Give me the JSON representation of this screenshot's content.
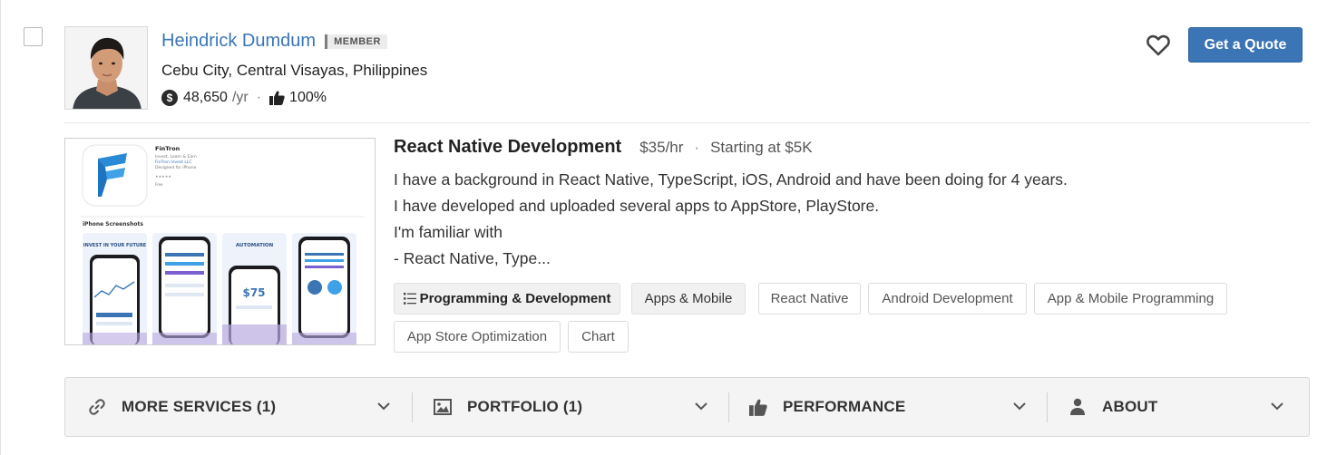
{
  "freelancer": {
    "name": "Heindrick Dumdum",
    "badge": "MEMBER",
    "location": "Cebu City, Central Visayas, Philippines",
    "earnings": "48,650",
    "earnings_unit": "/yr",
    "rating": "100%",
    "separator": "·"
  },
  "actions": {
    "quote_label": "Get a Quote",
    "favorite_icon": "heart-outline-icon"
  },
  "service": {
    "title": "React Native Development",
    "rate": "$35/hr",
    "separator": "·",
    "starting": "Starting at $5K",
    "description": [
      "I have a background in React Native, TypeScript, iOS, Android and have been doing for 4 years.",
      "I have developed and uploaded several apps to AppStore, PlayStore.",
      "I'm familiar with",
      "- React Native, Type..."
    ],
    "preview": {
      "app_name": "FinTron",
      "app_lines": [
        "Invest, Learn & Earn",
        "FinTron Invest LLC",
        "Designed for iPhone"
      ],
      "section_label": "iPhone Screenshots",
      "screens": [
        "INVEST IN YOUR FUTURE",
        "",
        "AUTOMATION",
        ""
      ]
    }
  },
  "tags": [
    {
      "label": "Programming & Development"
    },
    {
      "label": "Apps & Mobile"
    },
    {
      "label": "React Native"
    },
    {
      "label": "Android Development"
    },
    {
      "label": "App & Mobile Programming"
    },
    {
      "label": "App Store Optimization"
    },
    {
      "label": "Chart"
    }
  ],
  "tabs": [
    {
      "label": "MORE SERVICES (1)",
      "icon": "link-icon"
    },
    {
      "label": "PORTFOLIO (1)",
      "icon": "image-icon"
    },
    {
      "label": "PERFORMANCE",
      "icon": "thumbs-up-icon"
    },
    {
      "label": "ABOUT",
      "icon": "user-icon"
    }
  ],
  "colors": {
    "link": "#3a76b8",
    "button": "#3b75b5",
    "tag_border": "#dcdcdc"
  }
}
